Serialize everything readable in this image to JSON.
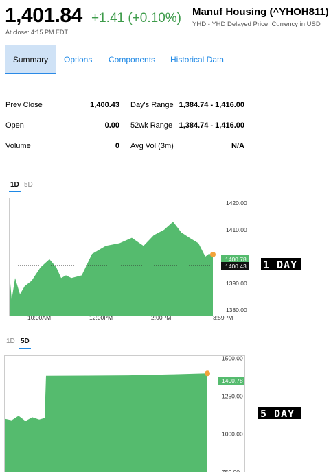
{
  "quote": {
    "price": "1,401.84",
    "change": "+1.41 (+0.10%)",
    "close_time": "At close: 4:15 PM EDT",
    "name": "Manuf Housing (^YHOH811)",
    "source": "YHD - YHD Delayed Price. Currency in USD"
  },
  "tabs": [
    "Summary",
    "Options",
    "Components",
    "Historical Data"
  ],
  "stats": {
    "prev_close_label": "Prev Close",
    "prev_close": "1,400.43",
    "open_label": "Open",
    "open": "0.00",
    "volume_label": "Volume",
    "volume": "0",
    "days_range_label": "Day's Range",
    "days_range": "1,384.74 - 1,416.00",
    "wk52_label": "52wk Range",
    "wk52_range": "1,384.74 - 1,416.00",
    "avg_vol_label": "Avg Vol (3m)",
    "avg_vol": "N/A"
  },
  "chart1": {
    "range_tabs": [
      "1D",
      "5D"
    ],
    "active": "1D",
    "price_tag": "1400.78",
    "prev_close_tag": "1400.43",
    "badge": "1 DAY",
    "line_color": "#55bb6e",
    "marker_color": "#f2a33a"
  },
  "chart2": {
    "range_tabs": [
      "1D",
      "5D"
    ],
    "active": "5D",
    "price_tag": "1400.78",
    "badge": "5 DAY"
  },
  "chart_data": [
    {
      "type": "area",
      "range": "1D",
      "ylim": [
        1378,
        1422
      ],
      "yticks": [
        "1420.00",
        "1410.00",
        "1390.00",
        "1380.00"
      ],
      "xticks": [
        "10:00AM",
        "12:00PM",
        "2:00PM",
        "3:59PM"
      ],
      "prev_close": 1400.43,
      "last": 1400.78,
      "x": [
        0,
        3,
        8,
        15,
        22,
        32,
        45,
        58,
        68,
        75,
        82,
        90,
        105,
        120,
        140,
        160,
        178,
        195,
        210,
        225,
        238,
        250,
        262,
        275,
        285,
        290,
        296
      ],
      "y": [
        1393,
        1384,
        1392,
        1386,
        1389,
        1391,
        1396,
        1399,
        1396,
        1392,
        1393,
        1392,
        1393,
        1401,
        1404,
        1405,
        1407,
        1404,
        1408,
        1410,
        1413,
        1409,
        1407,
        1405,
        1400,
        1401,
        1400.78
      ]
    },
    {
      "type": "area",
      "range": "5D",
      "ylim": [
        740,
        1520
      ],
      "yticks": [
        "1500.00",
        "1250.00",
        "1000.00",
        "750.00"
      ],
      "last": 1400.78,
      "x": [
        0,
        10,
        20,
        30,
        40,
        50,
        58,
        60,
        120,
        180,
        240,
        295
      ],
      "y": [
        1100,
        1090,
        1120,
        1085,
        1110,
        1095,
        1105,
        1385,
        1386,
        1388,
        1394,
        1400.78
      ]
    }
  ]
}
